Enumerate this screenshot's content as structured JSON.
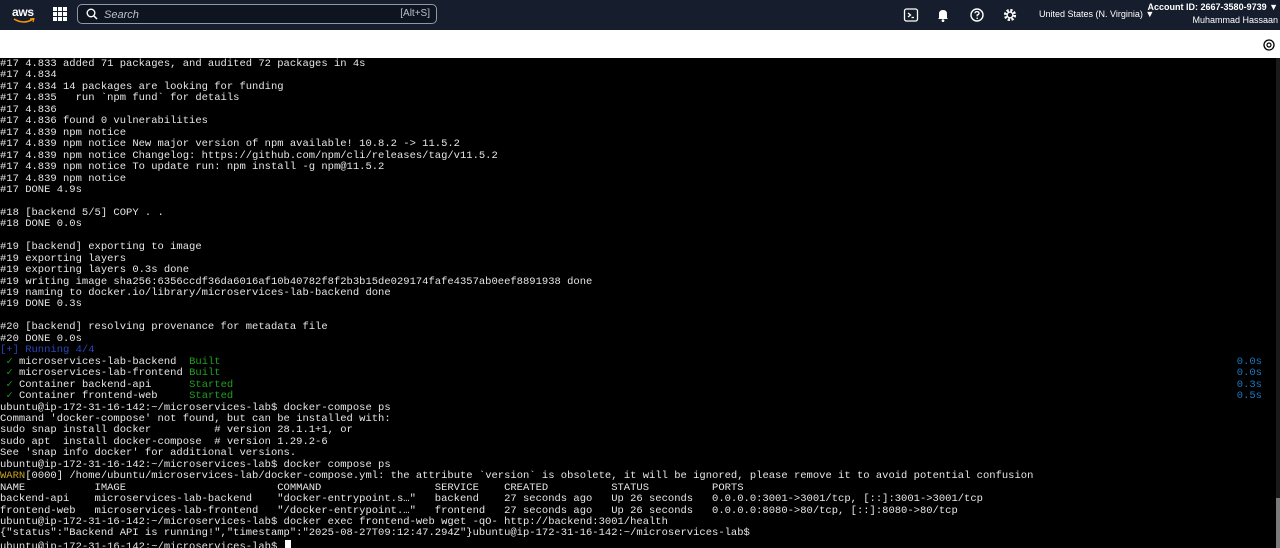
{
  "topbar": {
    "logo_text": "aws",
    "search": {
      "placeholder": "Search",
      "shortcut": "[Alt+S]"
    },
    "icons": [
      "cloudshell-icon",
      "bell-icon",
      "help-icon",
      "gear-icon"
    ],
    "region": "United States (N. Virginia) ▼",
    "account_id": "Account ID: 2667-3580-9739 ▼",
    "user_name": "Muhammad Hassaan"
  },
  "colors": {
    "topbar_bg": "#161e2d",
    "terminal_bg": "#000000",
    "terminal_text": "#e6e6e6",
    "built_green": "#1fa01f",
    "running_blue": "#2b45b8",
    "timing_blue": "#1a78c2",
    "warn_yellow": "#c7a21f"
  },
  "terminal": {
    "lines": [
      "#17 4.833 added 71 packages, and audited 72 packages in 4s",
      "#17 4.834",
      "#17 4.834 14 packages are looking for funding",
      "#17 4.835   run `npm fund` for details",
      "#17 4.836",
      "#17 4.836 found 0 vulnerabilities",
      "#17 4.839 npm notice",
      "#17 4.839 npm notice New major version of npm available! 10.8.2 -> 11.5.2",
      "#17 4.839 npm notice Changelog: https://github.com/npm/cli/releases/tag/v11.5.2",
      "#17 4.839 npm notice To update run: npm install -g npm@11.5.2",
      "#17 4.839 npm notice",
      "#17 DONE 4.9s",
      "",
      "#18 [backend 5/5] COPY . .",
      "#18 DONE 0.0s",
      "",
      "#19 [backend] exporting to image",
      "#19 exporting layers",
      "#19 exporting layers 0.3s done",
      "#19 writing image sha256:6356ccdf36da6016af10b40782f8f2b3b15de029174fafe4357ab0eef8891938 done",
      "#19 naming to docker.io/library/microservices-lab-backend done",
      "#19 DONE 0.3s",
      "",
      "#20 [backend] resolving provenance for metadata file",
      "#20 DONE 0.0s"
    ],
    "running_line": "[+] Running 4/4",
    "services": [
      {
        "check": "✓",
        "name": "microservices-lab-backend ",
        "status": "Built",
        "time": "0.0s"
      },
      {
        "check": "✓",
        "name": "microservices-lab-frontend",
        "status": "Built",
        "time": "0.0s"
      },
      {
        "check": "✓",
        "name": "Container backend-api     ",
        "status": "Started",
        "time": "0.3s"
      },
      {
        "check": "✓",
        "name": "Container frontend-web    ",
        "status": "Started",
        "time": "0.5s"
      }
    ],
    "after_lines": [
      "ubuntu@ip-172-31-16-142:~/microservices-lab$ docker-compose ps",
      "Command 'docker-compose' not found, but can be installed with:",
      "sudo snap install docker          # version 28.1.1+1, or",
      "sudo apt  install docker-compose  # version 1.29.2-6",
      "See 'snap info docker' for additional versions.",
      "ubuntu@ip-172-31-16-142:~/microservices-lab$ docker compose ps"
    ],
    "warn_prefix": "WARN",
    "warn_rest": "[0000] /home/ubuntu/microservices-lab/docker-compose.yml: the attribute `version` is obsolete, it will be ignored, please remove it to avoid potential confusion",
    "table_lines": [
      "NAME           IMAGE                        COMMAND                  SERVICE    CREATED          STATUS          PORTS",
      "backend-api    microservices-lab-backend    \"docker-entrypoint.s…\"   backend    27 seconds ago   Up 26 seconds   0.0.0.0:3001->3001/tcp, [::]:3001->3001/tcp",
      "frontend-web   microservices-lab-frontend   \"/docker-entrypoint.…\"   frontend   27 seconds ago   Up 26 seconds   0.0.0.0:8080->80/tcp, [::]:8080->80/tcp",
      "ubuntu@ip-172-31-16-142:~/microservices-lab$ docker exec frontend-web wget -qO- http://backend:3001/health",
      "{\"status\":\"Backend API is running!\",\"timestamp\":\"2025-08-27T09:12:47.294Z\"}ubuntu@ip-172-31-16-142:~/microservices-lab$"
    ],
    "prompt_line": "ubuntu@ip-172-31-16-142:~/microservices-lab$ "
  }
}
